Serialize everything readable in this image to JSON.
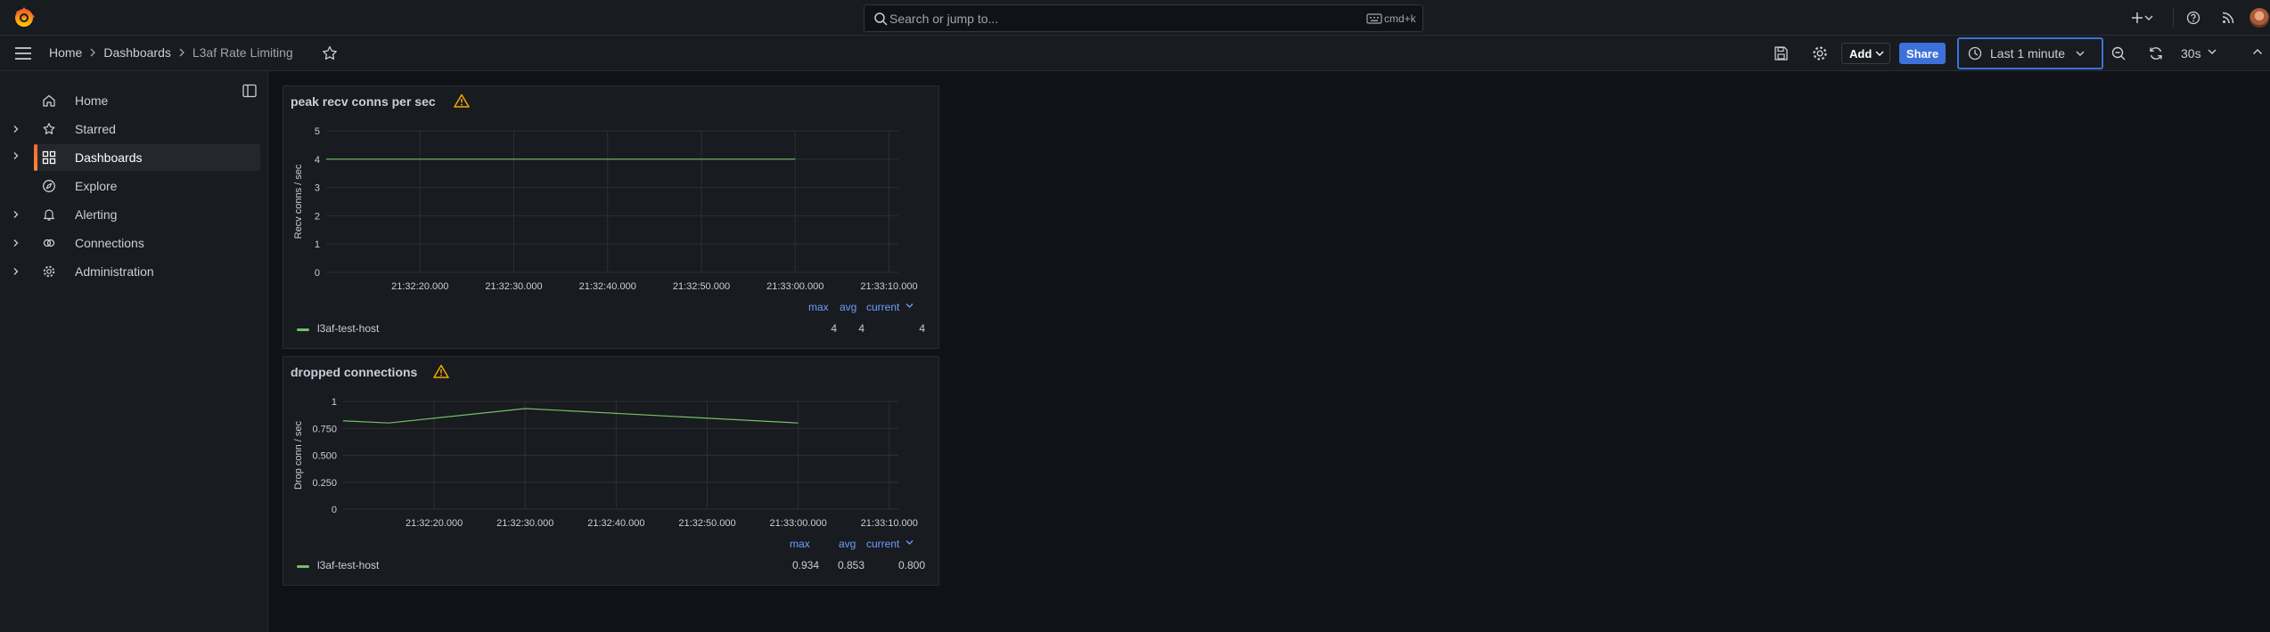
{
  "topbar": {
    "search_placeholder": "Search or jump to...",
    "search_shortcut": "cmd+k",
    "icons": [
      "grafana-logo-icon",
      "search-icon",
      "keyboard-icon",
      "plus-icon",
      "chevron-down-icon",
      "help-icon",
      "rss-icon",
      "avatar"
    ]
  },
  "breadcrumb": {
    "items": [
      "Home",
      "Dashboards",
      "L3af Rate Limiting"
    ]
  },
  "toolbar": {
    "add_label": "Add",
    "share_label": "Share",
    "time_range": "Last 1 minute",
    "refresh_interval": "30s"
  },
  "sidebar": {
    "items": [
      {
        "label": "Home",
        "icon": "home-icon",
        "expandable": false,
        "active": false
      },
      {
        "label": "Starred",
        "icon": "star-icon",
        "expandable": true,
        "active": false
      },
      {
        "label": "Dashboards",
        "icon": "apps-icon",
        "expandable": true,
        "active": true
      },
      {
        "label": "Explore",
        "icon": "compass-icon",
        "expandable": false,
        "active": false
      },
      {
        "label": "Alerting",
        "icon": "bell-icon",
        "expandable": true,
        "active": false
      },
      {
        "label": "Connections",
        "icon": "link-icon",
        "expandable": true,
        "active": false
      },
      {
        "label": "Administration",
        "icon": "cog-icon",
        "expandable": true,
        "active": false
      }
    ]
  },
  "colors": {
    "accent": "#3d71d9",
    "series": "#73bf69",
    "warning": "#f2a900",
    "active_bar": "#f86a2f",
    "legend_header": "#6e9fff"
  },
  "panels": [
    {
      "title": "peak recv conns per sec",
      "legend": {
        "headers": [
          "max",
          "avg",
          "current"
        ],
        "series_name": "l3af-test-host",
        "values": [
          "4",
          "4",
          "4"
        ]
      }
    },
    {
      "title": "dropped connections",
      "legend": {
        "headers": [
          "max",
          "avg",
          "current"
        ],
        "series_name": "l3af-test-host",
        "values": [
          "0.934",
          "0.853",
          "0.800"
        ]
      }
    }
  ],
  "chart_data": [
    {
      "type": "line",
      "title": "peak recv conns per sec",
      "ylabel": "Recv conns / sec",
      "xlabel": "",
      "ylim": [
        0,
        5
      ],
      "y_ticks": [
        "0",
        "1",
        "2",
        "3",
        "4",
        "5"
      ],
      "x_ticks": [
        "21:32:20.000",
        "21:32:30.000",
        "21:32:40.000",
        "21:32:50.000",
        "21:33:00.000",
        "21:33:10.000"
      ],
      "x_range": [
        "21:32:10.000",
        "21:33:11.000"
      ],
      "grid": true,
      "series": [
        {
          "name": "l3af-test-host",
          "x": [
            "21:32:10.000",
            "21:32:20.000",
            "21:32:30.000",
            "21:32:40.000",
            "21:32:50.000",
            "21:33:00.000"
          ],
          "values": [
            4,
            4,
            4,
            4,
            4,
            4
          ]
        }
      ]
    },
    {
      "type": "line",
      "title": "dropped connections",
      "ylabel": "Drop conn / sec",
      "xlabel": "",
      "ylim": [
        0,
        1
      ],
      "y_ticks": [
        "0",
        "0.250",
        "0.500",
        "0.750",
        "1"
      ],
      "x_ticks": [
        "21:32:20.000",
        "21:32:30.000",
        "21:32:40.000",
        "21:32:50.000",
        "21:33:00.000",
        "21:33:10.000"
      ],
      "x_range": [
        "21:32:10.000",
        "21:33:11.000"
      ],
      "grid": true,
      "series": [
        {
          "name": "l3af-test-host",
          "x": [
            "21:32:10.000",
            "21:32:15.000",
            "21:32:30.000",
            "21:33:00.000"
          ],
          "values": [
            0.82,
            0.8,
            0.934,
            0.8
          ]
        }
      ]
    }
  ]
}
